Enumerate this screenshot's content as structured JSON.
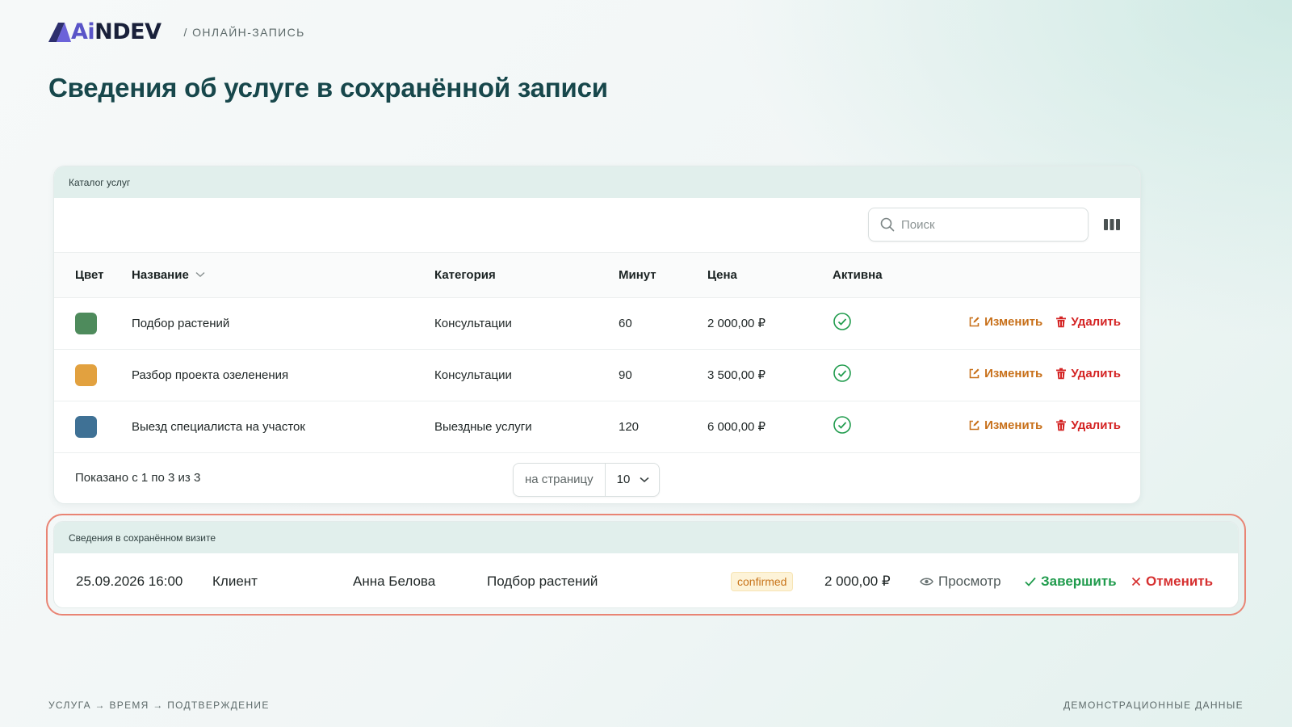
{
  "brand": {
    "logo_prefix": "Ai",
    "logo_suffix": "NDEV",
    "accent": "#5a55c8"
  },
  "breadcrumb": "/ ОНЛАЙН-ЗАПИСЬ",
  "page_title": "Сведения об услуге в сохранённой записи",
  "catalog": {
    "title": "Каталог услуг",
    "search_placeholder": "Поиск",
    "columns": {
      "color": "Цвет",
      "name": "Название",
      "category": "Категория",
      "minutes": "Минут",
      "price": "Цена",
      "active": "Активна"
    },
    "rows": [
      {
        "color": "#4e8b5c",
        "name": "Подбор растений",
        "category": "Консультации",
        "minutes": "60",
        "price": "2 000,00 ₽"
      },
      {
        "color": "#e2a13f",
        "name": "Разбор проекта озеленения",
        "category": "Консультации",
        "minutes": "90",
        "price": "3 500,00 ₽"
      },
      {
        "color": "#3f7195",
        "name": "Выезд специалиста на участок",
        "category": "Выездные услуги",
        "minutes": "120",
        "price": "6 000,00 ₽"
      }
    ],
    "edit_label": "Изменить",
    "delete_label": "Удалить",
    "shown_text": "Показано с 1 по 3 из 3",
    "per_page_label": "на страницу",
    "per_page_value": "10"
  },
  "visit": {
    "title": "Сведения в сохранённом визите",
    "datetime": "25.09.2026 16:00",
    "client_label": "Клиент",
    "client_name": "Анна Белова",
    "service": "Подбор растений",
    "status": "confirmed",
    "price": "2 000,00 ₽",
    "view_label": "Просмотр",
    "complete_label": "Завершить",
    "cancel_label": "Отменить"
  },
  "footer": {
    "steps": "УСЛУГА → ВРЕМЯ → ПОДТВЕРЖДЕНИЕ",
    "note": "ДЕМОНСТРАЦИОННЫЕ ДАННЫЕ"
  }
}
